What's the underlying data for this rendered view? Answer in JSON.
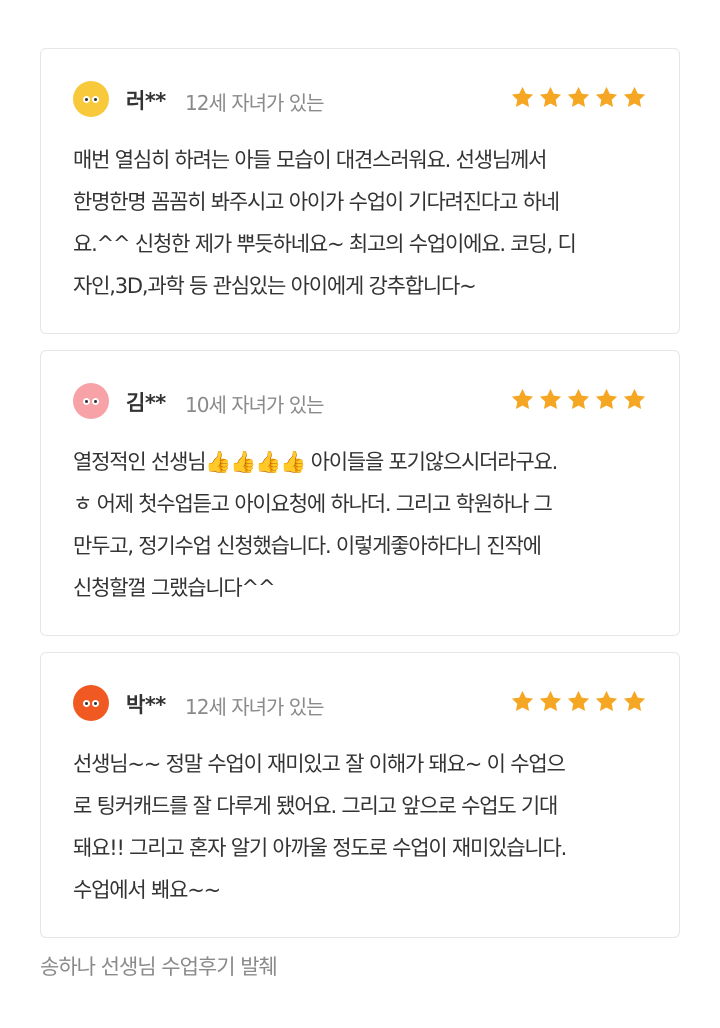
{
  "reviews": [
    {
      "name": "러**",
      "meta": "12세 자녀가 있는",
      "avatar": "yellow-face-avatar",
      "rating": 5,
      "lines": [
        "매번 열심히 하려는 아들 모습이 대견스러워요. 선생님께서",
        "한명한명 꼼꼼히 봐주시고 아이가 수업이 기다려진다고 하네",
        "요.^^ 신청한 제가 뿌듯하네요~ 최고의 수업이에요. 코딩, 디",
        "자인,3D,과학 등 관심있는 아이에게 강추합니다~"
      ]
    },
    {
      "name": "김**",
      "meta": "10세 자녀가 있는",
      "avatar": "pink-face-avatar",
      "rating": 5,
      "lines": [
        "열정적인 선생님👍👍👍👍 아이들을 포기않으시더라구요.",
        "ㅎ 어제 첫수업듣고 아이요청에 하나더. 그리고 학원하나 그",
        "만두고, 정기수업 신청했습니다. 이렇게좋아하다니 진작에",
        "신청할껄 그랬습니다^^"
      ]
    },
    {
      "name": "박**",
      "meta": "12세 자녀가 있는",
      "avatar": "orange-face-avatar",
      "rating": 5,
      "lines": [
        "선생님~~ 정말 수업이 재미있고 잘 이해가 돼요~ 이 수업으",
        "로 팅커캐드를 잘 다루게 됐어요. 그리고 앞으로 수업도 기대",
        "돼요!! 그리고 혼자 알기 아까울 정도로 수업이 재미있습니다.",
        "수업에서 봬요~~"
      ]
    }
  ],
  "caption": "송하나 선생님 수업후기 발췌",
  "colors": {
    "star": "#f5a623",
    "avatar_yellow": "#f8c93a",
    "avatar_pink": "#f6a2a7",
    "avatar_orange": "#f05a22",
    "border": "#e6e6e6"
  }
}
